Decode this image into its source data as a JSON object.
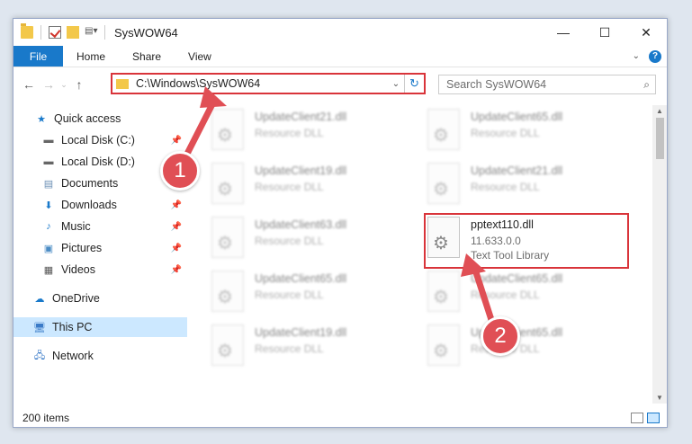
{
  "window": {
    "title": "SysWOW64"
  },
  "ribbon": {
    "file": "File",
    "tabs": [
      "Home",
      "Share",
      "View"
    ]
  },
  "address": {
    "path": "C:\\Windows\\SysWOW64"
  },
  "search": {
    "placeholder": "Search SysWOW64"
  },
  "sidebar": {
    "items": [
      {
        "label": "Quick access"
      },
      {
        "label": "Local Disk (C:)"
      },
      {
        "label": "Local Disk (D:)"
      },
      {
        "label": "Documents"
      },
      {
        "label": "Downloads"
      },
      {
        "label": "Music"
      },
      {
        "label": "Pictures"
      },
      {
        "label": "Videos"
      },
      {
        "label": "OneDrive"
      },
      {
        "label": "This PC"
      },
      {
        "label": "Network"
      }
    ]
  },
  "files": [
    {
      "name": "UpdateClient21.dll",
      "type": "Resource DLL"
    },
    {
      "name": "UpdateClient65.dll",
      "type": "Resource DLL"
    },
    {
      "name": "UpdateClient19.dll",
      "type": "Resource DLL"
    },
    {
      "name": "UpdateClient21.dll",
      "type": "Resource DLL"
    },
    {
      "name": "UpdateClient63.dll",
      "type": "Resource DLL"
    },
    {
      "name": "pptext110.dll",
      "version": "11.633.0.0",
      "type": "Text Tool Library"
    },
    {
      "name": "UpdateClient65.dll",
      "type": "Resource DLL"
    },
    {
      "name": "UpdateClient65.dll",
      "type": "Resource DLL"
    },
    {
      "name": "UpdateClient19.dll",
      "type": "Resource DLL"
    },
    {
      "name": "UpdateClient65.dll",
      "type": "Resource DLL"
    }
  ],
  "status": {
    "count": "200 items"
  },
  "callouts": {
    "one": "1",
    "two": "2"
  },
  "colors": {
    "accent": "#1979ca",
    "highlight": "#d9343a",
    "callout": "#e04f55"
  }
}
